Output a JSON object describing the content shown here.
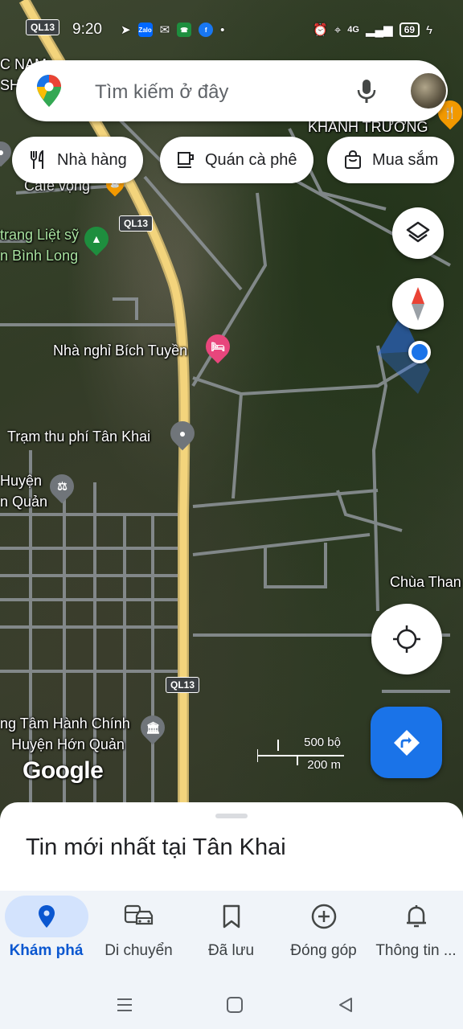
{
  "status_bar": {
    "time": "9:20",
    "battery": "69",
    "network": "4G"
  },
  "search": {
    "placeholder": "Tìm kiếm ở đây"
  },
  "chips": [
    {
      "label": "Nhà hàng",
      "icon": "fork-knife-icon"
    },
    {
      "label": "Quán cà phê",
      "icon": "coffee-cup-icon"
    },
    {
      "label": "Mua sắm",
      "icon": "shopping-bag-icon"
    }
  ],
  "map": {
    "labels": {
      "khanh_truong": "KHANH TRƯƠNG",
      "cafe_vong": "Cafe vọng",
      "trang_liet_sy": "trang Liệt sỹ",
      "binh_long": "n Bình Long",
      "nha_nghi": "Nhà nghỉ Bích Tuyền",
      "tram_thu_phi": "Trạm thu phí Tân Khai",
      "huyen": "Huyện",
      "quan": "n Quản",
      "chua_than": "Chùa Than",
      "trung_tam_line1": "ng Tâm Hành Chính",
      "trung_tam_line2": "Huyện Hớn Quản",
      "c_nam": "C NAM",
      "sh": "SH"
    },
    "road_shields": [
      "QL13",
      "QL13",
      "QL13"
    ],
    "scale": {
      "imperial": "500 bộ",
      "metric": "200 m"
    },
    "google_logo": "Google"
  },
  "sheet": {
    "title": "Tin mới nhất tại Tân Khai"
  },
  "bottom_nav": [
    {
      "label": "Khám phá",
      "icon": "explore-pin-icon",
      "active": true
    },
    {
      "label": "Di chuyển",
      "icon": "commute-icon",
      "active": false
    },
    {
      "label": "Đã lưu",
      "icon": "bookmark-icon",
      "active": false
    },
    {
      "label": "Đóng góp",
      "icon": "add-circle-icon",
      "active": false
    },
    {
      "label": "Thông tin ...",
      "icon": "bell-icon",
      "active": false
    }
  ],
  "colors": {
    "accent": "#1a73e8",
    "active_nav": "#0b57d0",
    "active_pill": "#d3e3fd",
    "poi_pink": "#e8467c",
    "poi_green": "#1e8e3e",
    "poi_gray": "#70757a",
    "road_yellow": "#f3d47c"
  }
}
